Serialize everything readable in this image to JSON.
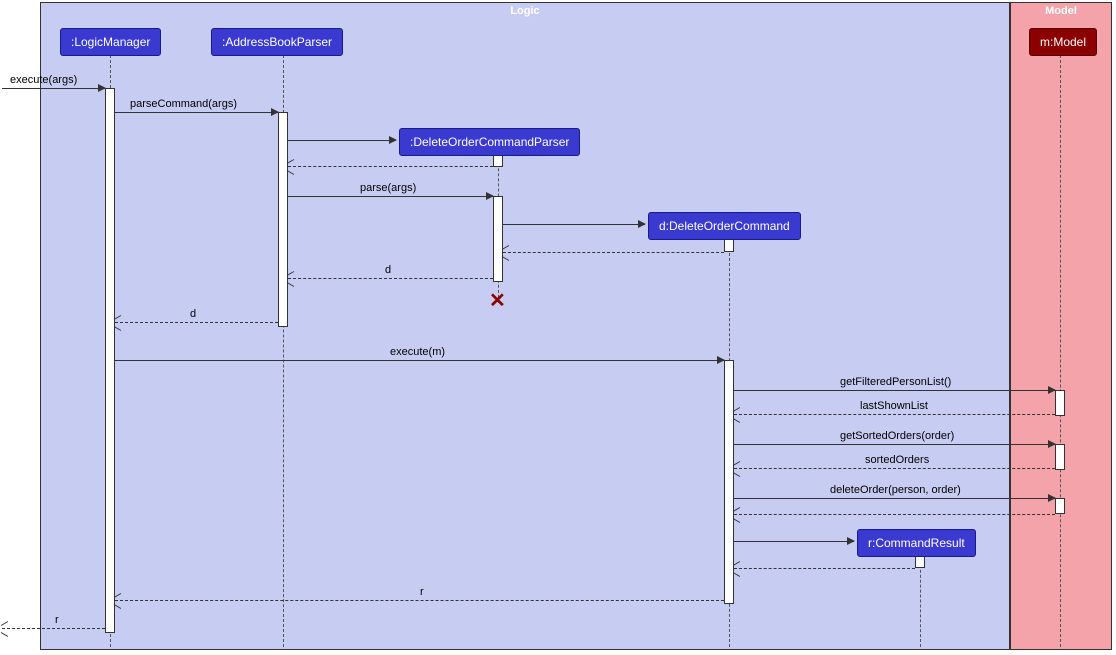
{
  "frames": {
    "logic": "Logic",
    "model": "Model"
  },
  "participants": {
    "logic_manager": ":LogicManager",
    "parser": ":AddressBookParser",
    "doc_parser": ":DeleteOrderCommandParser",
    "command": "d:DeleteOrderCommand",
    "result": "r:CommandResult",
    "model": "m:Model"
  },
  "messages": {
    "execute_args": "execute(args)",
    "parse_command": "parseCommand(args)",
    "parse_args": "parse(args)",
    "ret_d1": "d",
    "ret_d2": "d",
    "execute_m": "execute(m)",
    "get_filtered": "getFilteredPersonList()",
    "last_shown": "lastShownList",
    "get_sorted": "getSortedOrders(order)",
    "sorted_orders": "sortedOrders",
    "delete_order": "deleteOrder(person, order)",
    "ret_r1": "r",
    "ret_r2": "r"
  },
  "chart_data": {
    "type": "sequence-diagram",
    "frames": [
      {
        "name": "Logic",
        "contains": [
          ":LogicManager",
          ":AddressBookParser",
          ":DeleteOrderCommandParser",
          "d:DeleteOrderCommand",
          "r:CommandResult"
        ]
      },
      {
        "name": "Model",
        "contains": [
          "m:Model"
        ]
      }
    ],
    "participants": [
      {
        "id": "caller",
        "name": "(external)"
      },
      {
        "id": "lm",
        "name": ":LogicManager"
      },
      {
        "id": "abp",
        "name": ":AddressBookParser"
      },
      {
        "id": "docp",
        "name": ":DeleteOrderCommandParser",
        "created": true,
        "destroyed": true
      },
      {
        "id": "doc",
        "name": "d:DeleteOrderCommand",
        "created": true
      },
      {
        "id": "cr",
        "name": "r:CommandResult",
        "created": true
      },
      {
        "id": "model",
        "name": "m:Model"
      }
    ],
    "messages": [
      {
        "from": "caller",
        "to": "lm",
        "label": "execute(args)",
        "type": "sync"
      },
      {
        "from": "lm",
        "to": "abp",
        "label": "parseCommand(args)",
        "type": "sync"
      },
      {
        "from": "abp",
        "to": "docp",
        "label": "",
        "type": "create"
      },
      {
        "from": "docp",
        "to": "abp",
        "label": "",
        "type": "return"
      },
      {
        "from": "abp",
        "to": "docp",
        "label": "parse(args)",
        "type": "sync"
      },
      {
        "from": "docp",
        "to": "doc",
        "label": "",
        "type": "create"
      },
      {
        "from": "doc",
        "to": "docp",
        "label": "",
        "type": "return"
      },
      {
        "from": "docp",
        "to": "abp",
        "label": "d",
        "type": "return"
      },
      {
        "from": "docp",
        "to": null,
        "label": "",
        "type": "destroy"
      },
      {
        "from": "abp",
        "to": "lm",
        "label": "d",
        "type": "return"
      },
      {
        "from": "lm",
        "to": "doc",
        "label": "execute(m)",
        "type": "sync"
      },
      {
        "from": "doc",
        "to": "model",
        "label": "getFilteredPersonList()",
        "type": "sync"
      },
      {
        "from": "model",
        "to": "doc",
        "label": "lastShownList",
        "type": "return"
      },
      {
        "from": "doc",
        "to": "model",
        "label": "getSortedOrders(order)",
        "type": "sync"
      },
      {
        "from": "model",
        "to": "doc",
        "label": "sortedOrders",
        "type": "return"
      },
      {
        "from": "doc",
        "to": "model",
        "label": "deleteOrder(person, order)",
        "type": "sync"
      },
      {
        "from": "model",
        "to": "doc",
        "label": "",
        "type": "return"
      },
      {
        "from": "doc",
        "to": "cr",
        "label": "",
        "type": "create"
      },
      {
        "from": "cr",
        "to": "doc",
        "label": "",
        "type": "return"
      },
      {
        "from": "doc",
        "to": "lm",
        "label": "r",
        "type": "return"
      },
      {
        "from": "lm",
        "to": "caller",
        "label": "r",
        "type": "return"
      }
    ]
  }
}
